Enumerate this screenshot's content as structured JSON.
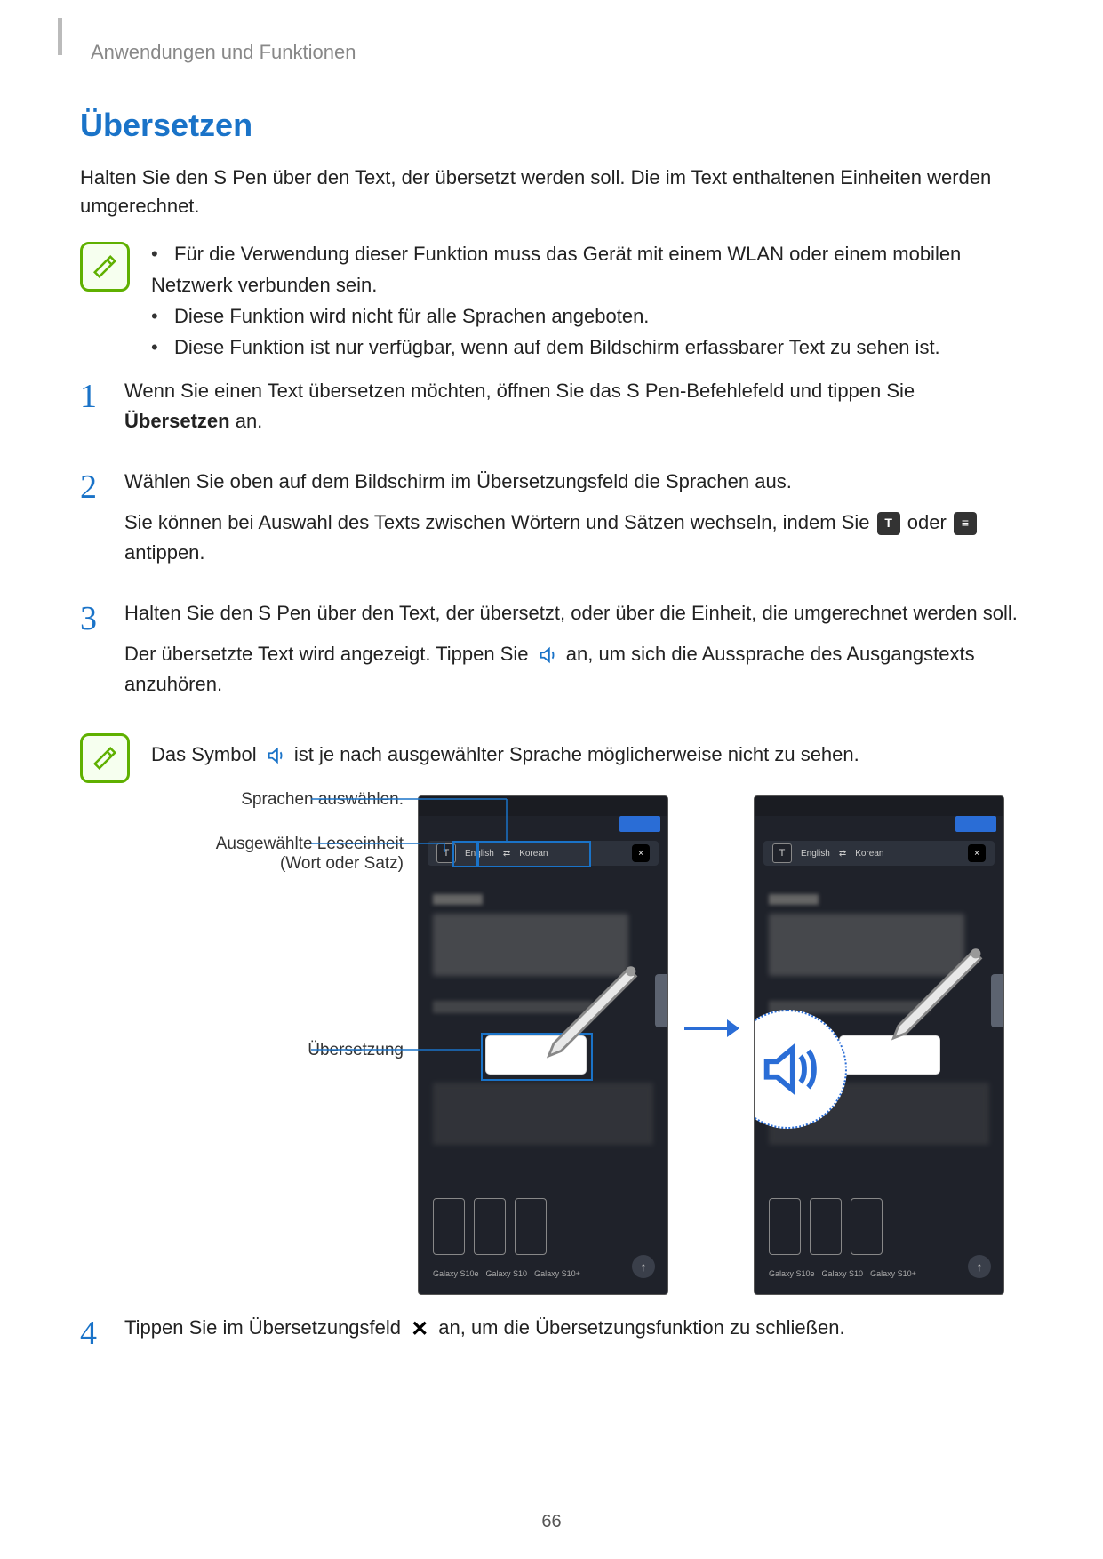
{
  "breadcrumb": "Anwendungen und Funktionen",
  "section_title": "Übersetzen",
  "intro": "Halten Sie den S Pen über den Text, der übersetzt werden soll. Die im Text enthaltenen Einheiten werden umgerechnet.",
  "notes1": {
    "items": [
      "Für die Verwendung dieser Funktion muss das Gerät mit einem WLAN oder einem mobilen Netzwerk verbunden sein.",
      "Diese Funktion wird nicht für alle Sprachen angeboten.",
      "Diese Funktion ist nur verfügbar, wenn auf dem Bildschirm erfassbarer Text zu sehen ist."
    ]
  },
  "steps": {
    "s1_a": "Wenn Sie einen Text übersetzen möchten, öffnen Sie das S Pen-Befehlefeld und tippen Sie ",
    "s1_bold": "Übersetzen",
    "s1_b": " an.",
    "s2_a": "Wählen Sie oben auf dem Bildschirm im Übersetzungsfeld die Sprachen aus.",
    "s2_b1": "Sie können bei Auswahl des Texts zwischen Wörtern und Sätzen wechseln, indem Sie ",
    "s2_b2": " oder ",
    "s2_b3": " antippen.",
    "s3_a": "Halten Sie den S Pen über den Text, der übersetzt, oder über die Einheit, die umgerechnet werden soll.",
    "s3_b1": "Der übersetzte Text wird angezeigt. Tippen Sie ",
    "s3_b2": " an, um sich die Aussprache des Ausgangstexts anzuhören.",
    "s4_a": "Tippen Sie im Übersetzungsfeld ",
    "s4_b": " an, um die Übersetzungsfunktion zu schließen."
  },
  "notes2": {
    "text_a": "Das Symbol ",
    "text_b": " ist je nach ausgewählter Sprache möglicherweise nicht zu sehen."
  },
  "callouts": {
    "lang": "Sprachen auswählen.",
    "unit": "Ausgewählte Leseeinheit (Wort oder Satz)",
    "translation": "Übersetzung"
  },
  "phone": {
    "toolbar": {
      "mode": "T",
      "swap": "⇄",
      "lang1": "English",
      "lang2": "Korean",
      "close": "×"
    },
    "thumb_labels": [
      "Galaxy S10e",
      "Galaxy S10",
      "Galaxy S10+"
    ]
  },
  "page_number": "66"
}
